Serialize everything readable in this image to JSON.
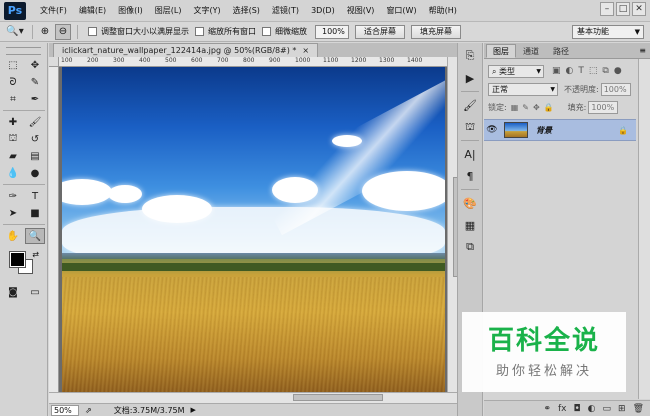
{
  "app": {
    "logo": "Ps"
  },
  "menu": [
    "文件(F)",
    "编辑(E)",
    "图像(I)",
    "图层(L)",
    "文字(Y)",
    "选择(S)",
    "滤镜(T)",
    "3D(D)",
    "视图(V)",
    "窗口(W)",
    "帮助(H)"
  ],
  "window_controls": {
    "minimize": "–",
    "restore": "□",
    "close": "✕"
  },
  "options": {
    "tool_icon": "zoom-icon",
    "chk_resize": "调整窗口大小以满屏显示",
    "chk_zoom_all": "缩放所有窗口",
    "chk_scrubby": "细微缩放",
    "zoom_value": "100%",
    "fit_screen": "适合屏幕",
    "fill_screen": "填充屏幕",
    "workspace": "基本功能"
  },
  "document": {
    "tab_title": "iclickart_nature_wallpaper_122414a.jpg @ 50%(RGB/8#) *",
    "tab_close": "×",
    "ruler_labels": [
      "100",
      "200",
      "300",
      "400",
      "500",
      "600",
      "700",
      "800",
      "900",
      "1000",
      "1100",
      "1200",
      "1300",
      "1400",
      "1500"
    ]
  },
  "status": {
    "zoom": "50%",
    "doc_info": "文档:3.75M/3.75M",
    "arrow": "▶"
  },
  "layers_panel": {
    "tabs": [
      "图层",
      "通道",
      "路径"
    ],
    "filter_type": "类型",
    "blend_mode": "正常",
    "opacity_label": "不透明度:",
    "opacity_value": "100%",
    "lock_label": "锁定:",
    "fill_label": "填充:",
    "fill_value": "100%",
    "layers": [
      {
        "name": "背景",
        "visible": true,
        "locked": true
      }
    ],
    "bottom_icons": [
      "link-icon",
      "fx-icon",
      "mask-icon",
      "adjustment-icon",
      "group-icon",
      "new-layer-icon",
      "trash-icon"
    ]
  },
  "watermark": {
    "main": "百科全说",
    "sub": "助你轻松解决"
  },
  "colors": {
    "foreground": "#000000",
    "background": "#ffffff",
    "selected_layer": "#a9bde0"
  }
}
